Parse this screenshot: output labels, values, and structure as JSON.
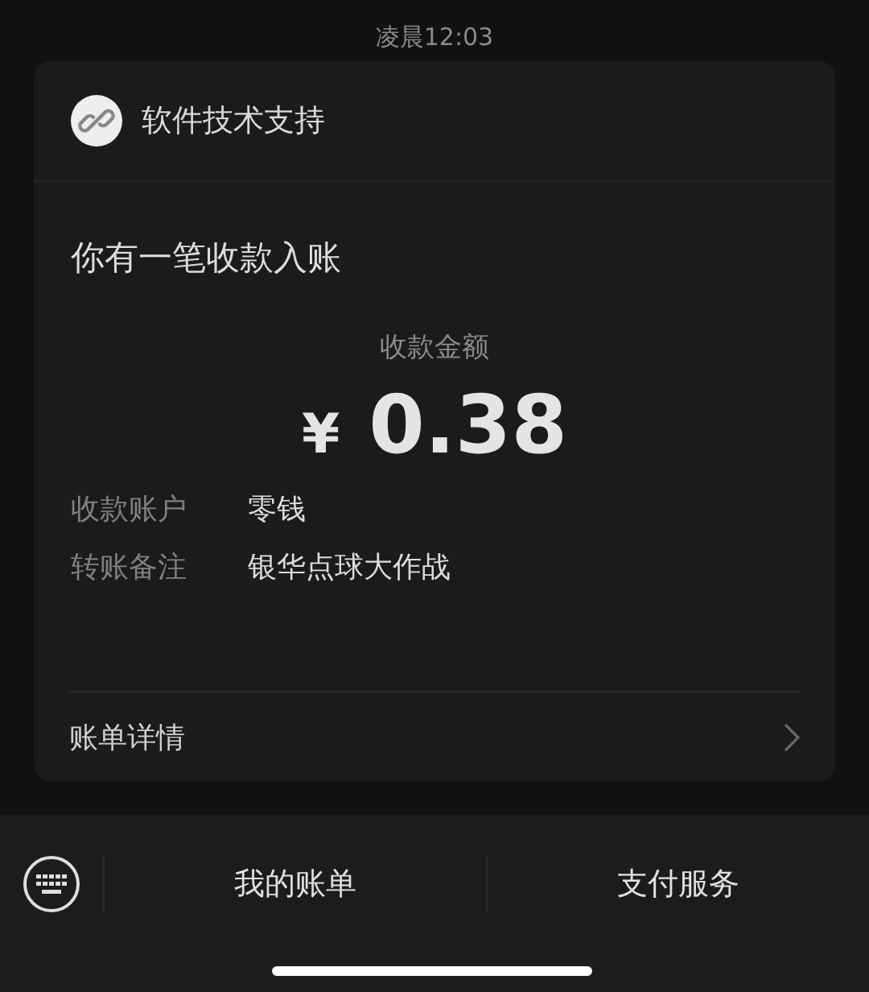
{
  "time": "凌晨12:03",
  "card": {
    "sender": "软件技术支持",
    "title": "你有一笔收款入账",
    "amount_label": "收款金额",
    "currency": "¥",
    "amount": "0.38",
    "fields": [
      {
        "label": "收款账户",
        "value": "零钱"
      },
      {
        "label": "转账备注",
        "value": "银华点球大作战"
      }
    ],
    "detail_link": "账单详情"
  },
  "menu": [
    "我的账单",
    "支付服务"
  ]
}
